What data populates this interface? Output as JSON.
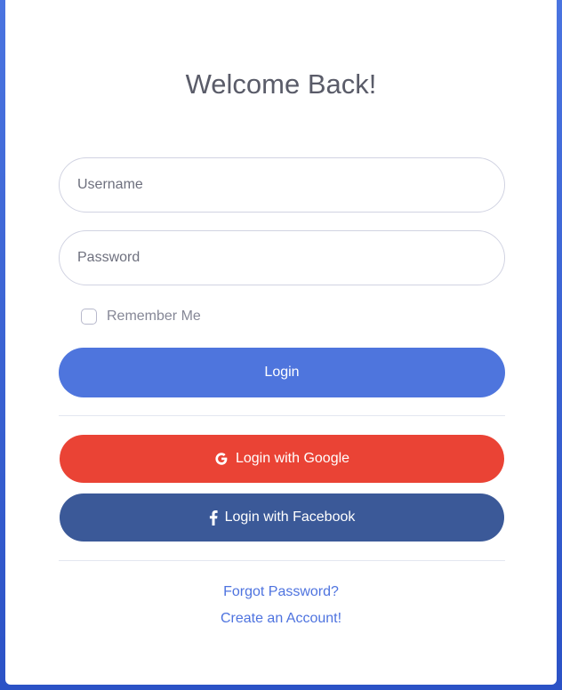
{
  "header": {
    "title": "Welcome Back!"
  },
  "form": {
    "username": {
      "value": "",
      "placeholder": "Username"
    },
    "password": {
      "value": "",
      "placeholder": "Password"
    },
    "remember_label": "Remember Me",
    "remember_checked": false,
    "login_label": "Login"
  },
  "social": {
    "google_label": "Login with Google",
    "google_icon": "google-icon",
    "google_color": "#ea4335",
    "facebook_label": "Login with Facebook",
    "facebook_icon": "facebook-icon",
    "facebook_color": "#3b5998"
  },
  "links": {
    "forgot": "Forgot Password?",
    "create": "Create an Account!"
  },
  "colors": {
    "primary": "#4e75dd",
    "background": "#3b63d6",
    "link": "#4e73df"
  }
}
